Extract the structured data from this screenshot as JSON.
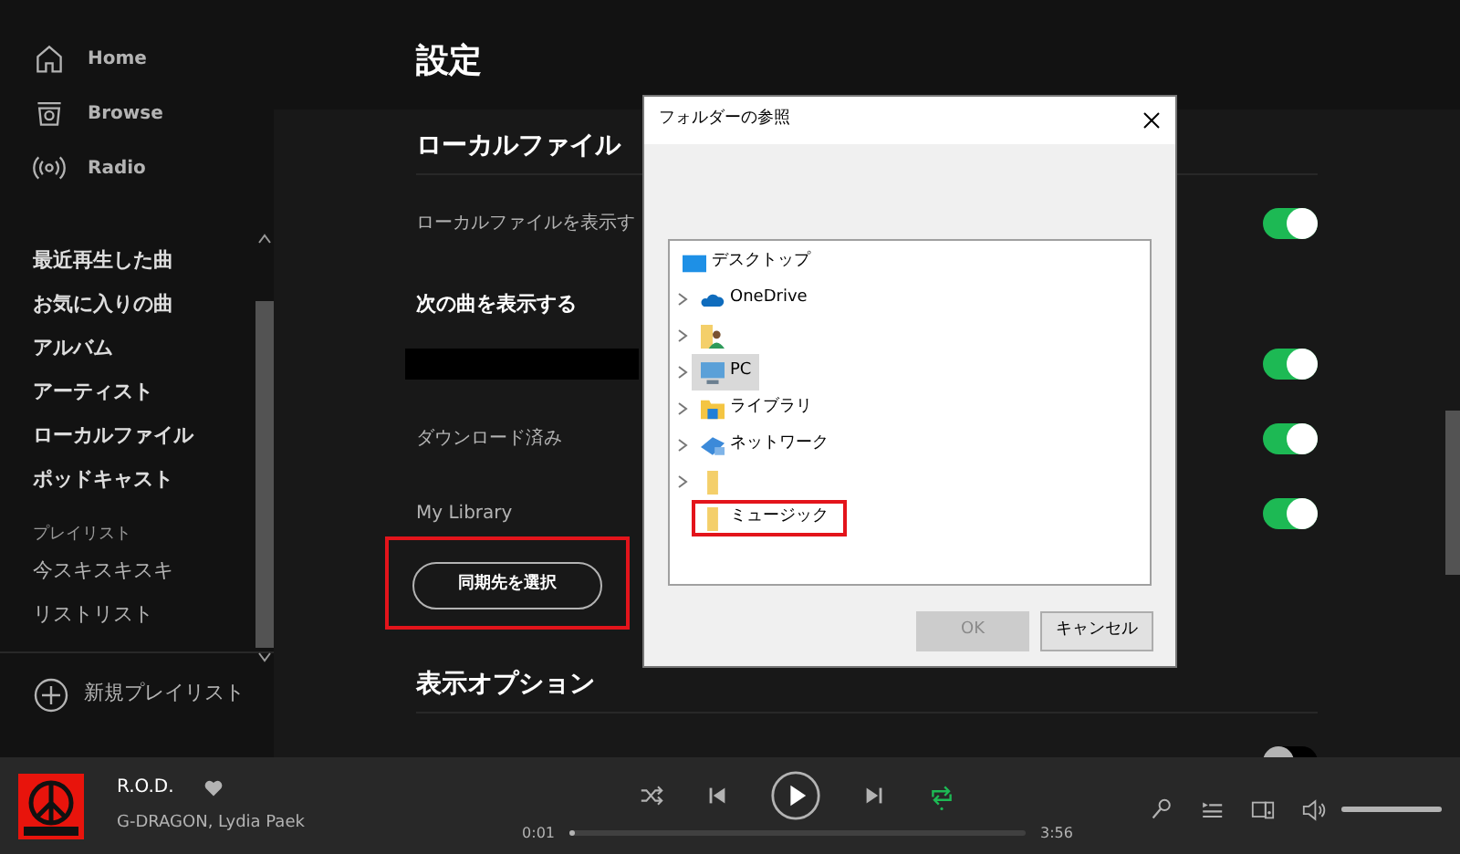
{
  "sidebar": {
    "nav": [
      {
        "label": "Home"
      },
      {
        "label": "Browse"
      },
      {
        "label": "Radio"
      }
    ],
    "library": [
      "最近再生した曲",
      "お気に入りの曲",
      "アルバム",
      "アーティスト",
      "ローカルファイル",
      "ポッドキャスト"
    ],
    "playlists_heading": "プレイリスト",
    "playlists": [
      "今スキスキスキ",
      "リストリスト"
    ],
    "new_playlist": "新規プレイリスト"
  },
  "settings": {
    "title": "設定",
    "sections": [
      {
        "heading": "ローカルファイル",
        "rows": [
          {
            "kind": "toggle",
            "label": "ローカルファイルを表示す",
            "on": true
          },
          {
            "kind": "subheading",
            "label": "次の曲を表示する"
          },
          {
            "kind": "redacted",
            "on": true
          },
          {
            "kind": "toggle",
            "label": "ダウンロード済み",
            "on": true
          },
          {
            "kind": "toggle",
            "label": "My Library",
            "on": true
          },
          {
            "kind": "button",
            "label": "同期先を選択",
            "highlighted": true
          }
        ]
      },
      {
        "heading": "表示オプション",
        "rows": [
          {
            "kind": "toggle",
            "on": false
          }
        ]
      }
    ]
  },
  "dialog": {
    "title": "フォルダーの参照",
    "items": [
      {
        "label": "デスクトップ",
        "expandable": false,
        "selected": false,
        "highlighted": false
      },
      {
        "label": "OneDrive",
        "expandable": true,
        "selected": false,
        "highlighted": false
      },
      {
        "expandable": true,
        "selected": false,
        "highlighted": false
      },
      {
        "label": "PC",
        "expandable": true,
        "selected": true,
        "highlighted": false
      },
      {
        "label": "ライブラリ",
        "expandable": true,
        "selected": false,
        "highlighted": false
      },
      {
        "label": "ネットワーク",
        "expandable": true,
        "selected": false,
        "highlighted": false
      },
      {
        "expandable": true,
        "selected": false,
        "highlighted": false
      },
      {
        "label": "ミュージック",
        "expandable": false,
        "selected": false,
        "highlighted": true
      }
    ],
    "buttons": [
      {
        "label": "OK",
        "disabled": true
      },
      {
        "label": "キャンセル",
        "disabled": false
      }
    ]
  },
  "player": {
    "title": "R.O.D.",
    "artist": "G-DRAGON, Lydia Paek",
    "shuffle": false,
    "repeat": true,
    "elapsed": "0:01",
    "duration": "3:56",
    "progress": {
      "level": 0.01
    },
    "volume": {
      "level": 1.0
    }
  }
}
